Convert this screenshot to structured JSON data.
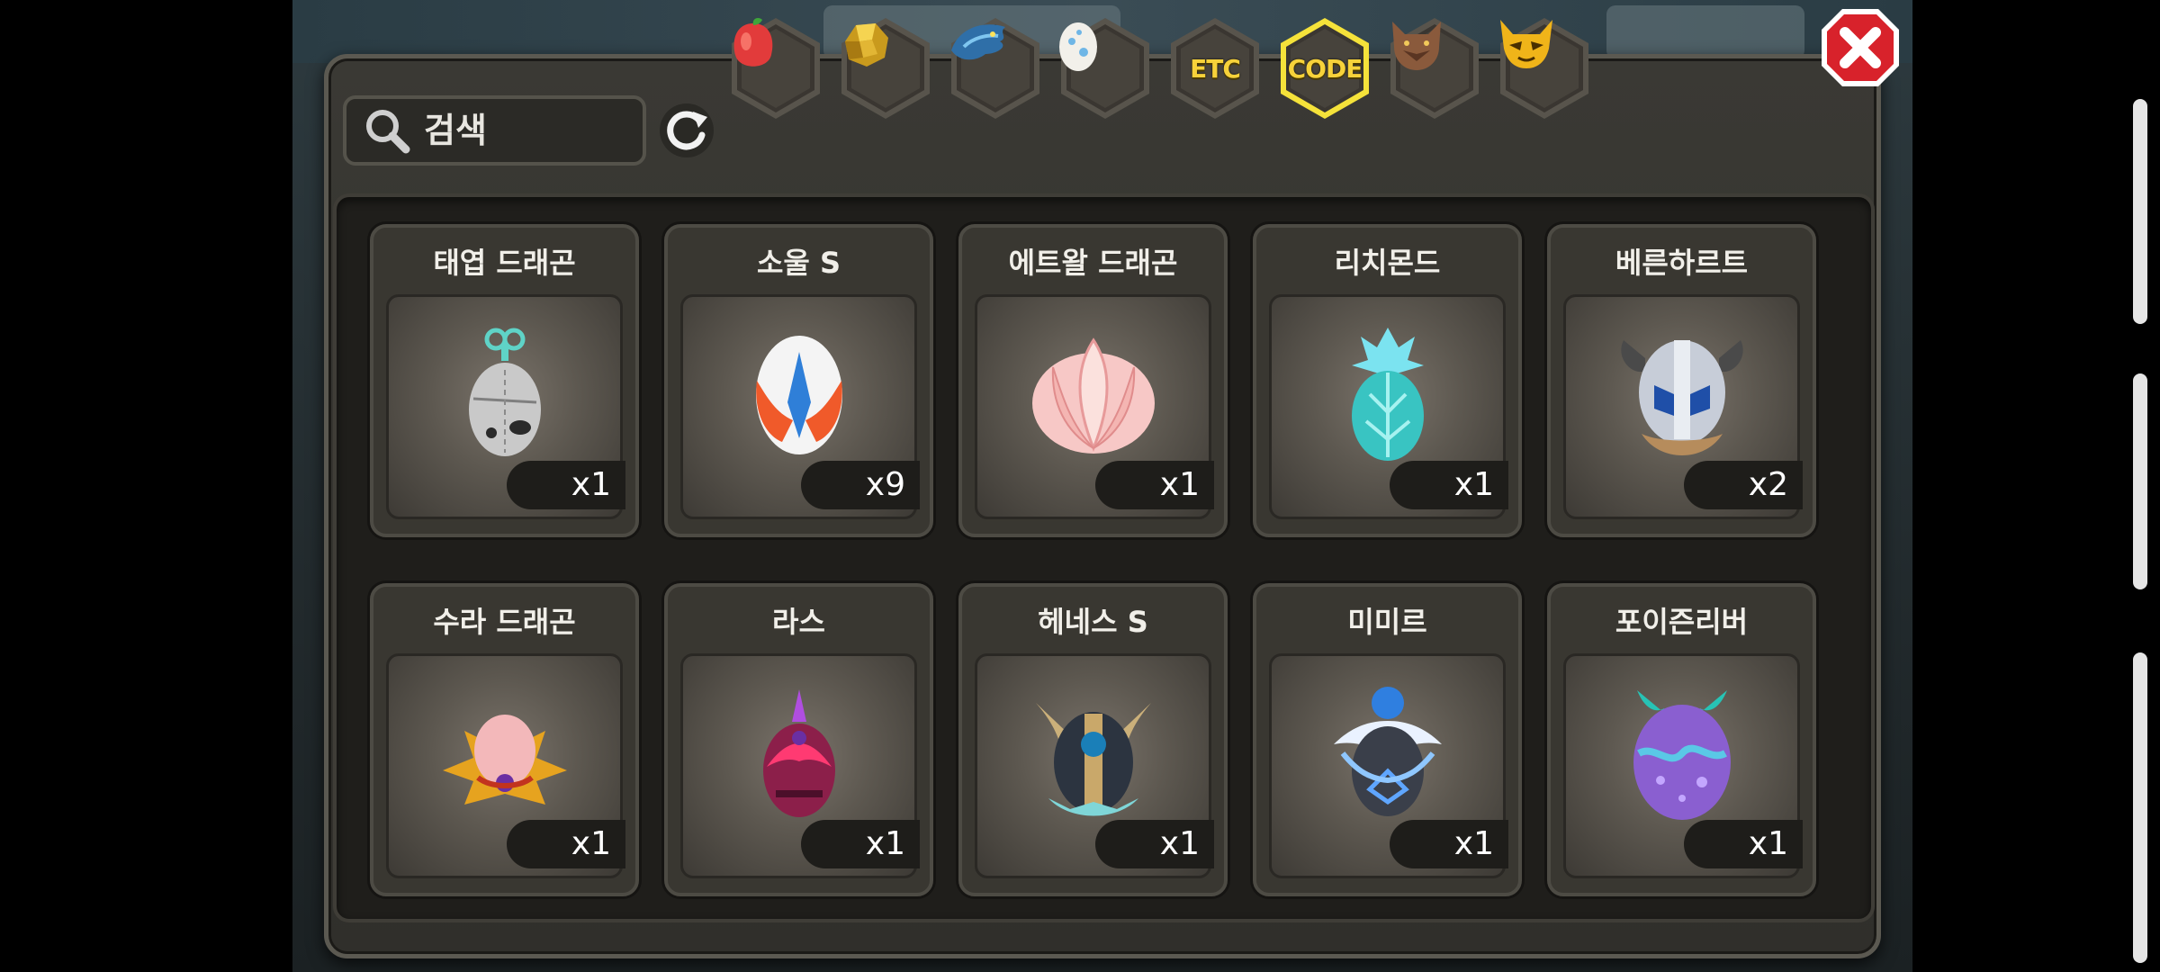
{
  "search": {
    "placeholder": "검색"
  },
  "tabs": [
    {
      "name": "fruit-tab",
      "label": "",
      "icon": "red-fruit-icon"
    },
    {
      "name": "gold-tab",
      "label": "",
      "icon": "gold-ore-icon"
    },
    {
      "name": "dragon-tab",
      "label": "",
      "icon": "dragon-head-icon"
    },
    {
      "name": "egg-tab",
      "label": "",
      "icon": "egg-icon"
    },
    {
      "name": "etc-tab",
      "label": "ETC",
      "icon": ""
    },
    {
      "name": "code-tab",
      "label": "CODE",
      "icon": "",
      "selected": true
    },
    {
      "name": "wolf-tab",
      "label": "",
      "icon": "wolf-head-icon"
    },
    {
      "name": "mask-tab",
      "label": "",
      "icon": "horned-mask-icon"
    }
  ],
  "items": [
    {
      "name": "태엽 드래곤",
      "count": "x1"
    },
    {
      "name": "소울 S",
      "count": "x9"
    },
    {
      "name": "에트왈 드래곤",
      "count": "x1"
    },
    {
      "name": "리치몬드",
      "count": "x1"
    },
    {
      "name": "베른하르트",
      "count": "x2"
    },
    {
      "name": "수라 드래곤",
      "count": "x1"
    },
    {
      "name": "라스",
      "count": "x1"
    },
    {
      "name": "헤네스 S",
      "count": "x1"
    },
    {
      "name": "미미르",
      "count": "x1"
    },
    {
      "name": "포이즌리버",
      "count": "x1"
    }
  ],
  "colors": {
    "selected_tab_border": "#f5e23a",
    "tab_gold_text": "#f7d23a",
    "close_red": "#d8222b"
  }
}
